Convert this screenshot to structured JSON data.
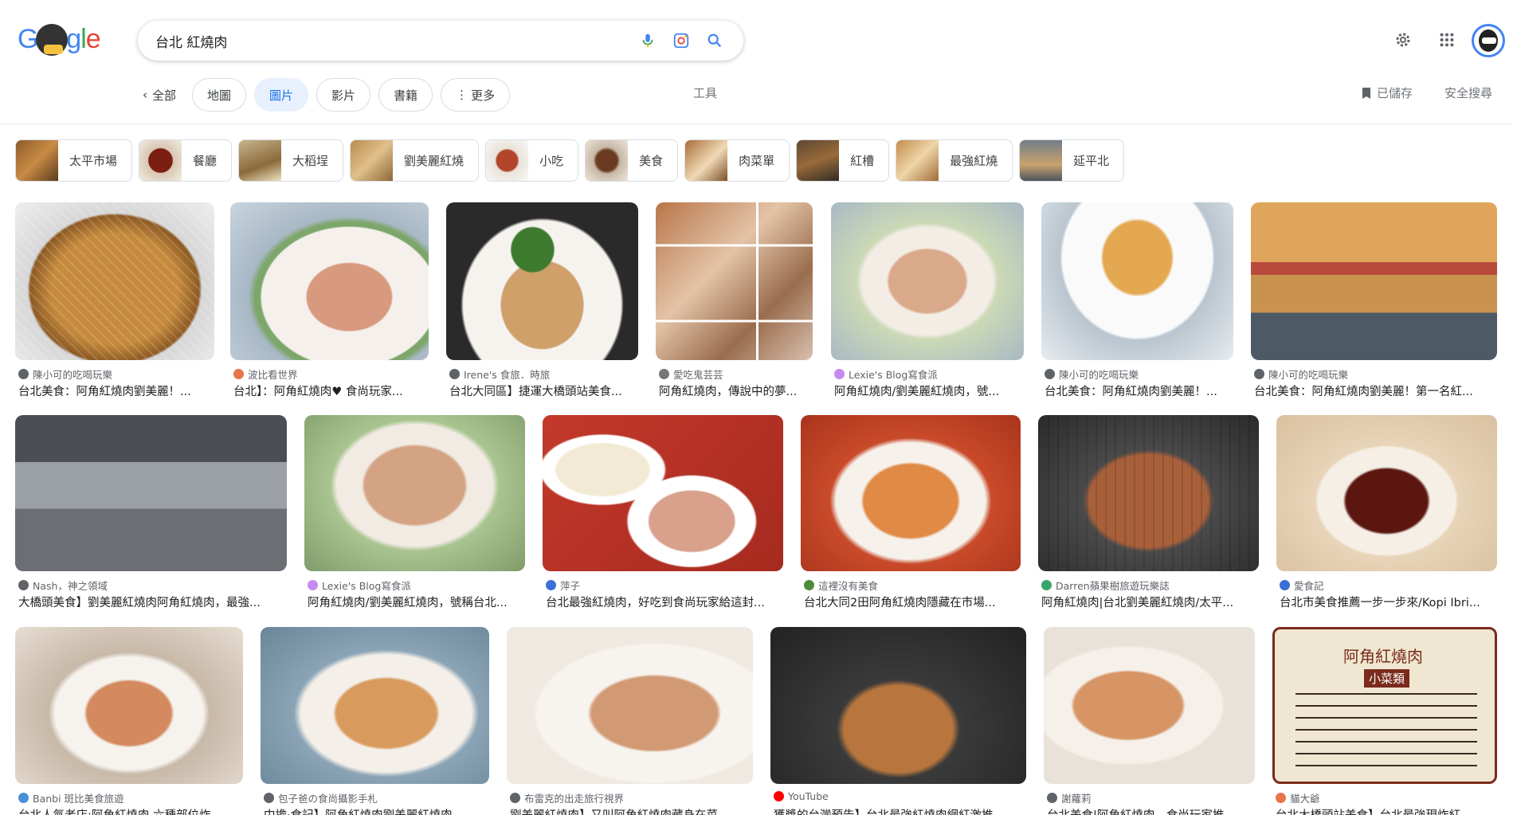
{
  "logo": {
    "text": "Google"
  },
  "search": {
    "query": "台北 紅燒肉"
  },
  "icons": {
    "mic": "mic-icon",
    "lens": "camera-lens-icon",
    "search": "search-icon",
    "settings": "gear-icon",
    "apps": "grid-apps-icon",
    "saved": "bookmark-icon"
  },
  "tabs": {
    "back_label": "全部",
    "items": [
      {
        "label": "地圖",
        "active": false
      },
      {
        "label": "圖片",
        "active": true
      },
      {
        "label": "影片",
        "active": false
      },
      {
        "label": "書籍",
        "active": false
      },
      {
        "label": "更多",
        "active": false
      }
    ],
    "tools": "工具",
    "saved": "已儲存",
    "safesearch": "安全搜尋"
  },
  "related": [
    {
      "label": "太平市場"
    },
    {
      "label": "餐廳"
    },
    {
      "label": "大稻埕"
    },
    {
      "label": "劉美麗紅燒"
    },
    {
      "label": "小吃"
    },
    {
      "label": "美食"
    },
    {
      "label": "肉菜單"
    },
    {
      "label": "紅槽"
    },
    {
      "label": "最強紅燒"
    },
    {
      "label": "延平北"
    }
  ],
  "results": [
    {
      "source": "陳小可的吃喝玩樂",
      "title": "台北美食：阿角紅燒肉劉美麗！..."
    },
    {
      "source": "波比看世界",
      "title": "台北】：阿角紅燒肉♥ 食尚玩家..."
    },
    {
      "source": "Irene's 食旅．時旅",
      "title": "台北大同區】捷運大橋頭站美食..."
    },
    {
      "source": "愛吃鬼芸芸",
      "title": "阿角紅燒肉，傳說中的夢..."
    },
    {
      "source": "Lexie's Blog寫食派",
      "title": "阿角紅燒肉/劉美麗紅燒肉，號..."
    },
    {
      "source": "陳小可的吃喝玩樂",
      "title": "台北美食：阿角紅燒肉劉美麗！..."
    },
    {
      "source": "陳小可的吃喝玩樂",
      "title": "台北美食：阿角紅燒肉劉美麗！第一名紅..."
    },
    {
      "source": "Nash，神之領域",
      "title": "大橋頭美食】劉美麗紅燒肉阿角紅燒肉，最強..."
    },
    {
      "source": "Lexie's Blog寫食派",
      "title": "阿角紅燒肉/劉美麗紅燒肉，號稱台北..."
    },
    {
      "source": "萍子",
      "title": "台北最強紅燒肉，好吃到食尚玩家給這封..."
    },
    {
      "source": "這裡沒有美食",
      "title": "台北大同2田阿角紅燒肉隱藏在市場..."
    },
    {
      "source": "Darren蘋果樹旅遊玩樂誌",
      "title": "阿角紅燒肉|台北劉美麗紅燒肉/太平..."
    },
    {
      "source": "愛食記",
      "title": "台北市美食推薦一步一步來/Kopi Ibri..."
    },
    {
      "source": "Banbi 斑比美食旅遊",
      "title": "台北人氣老店:阿角紅燒肉 六種部位炸..."
    },
    {
      "source": "包子爸の食尚攝影手札",
      "title": "中擔·食記】阿角紅燒肉劉美麗紅燒肉..."
    },
    {
      "source": "布雷克的出走旅行視界",
      "title": "劉美麗紅燒肉】又叫阿角紅燒肉藏身在菜..."
    },
    {
      "source": "YouTube",
      "title": "獲獎的台灣預告】台北最強紅燒肉網紅激推..."
    },
    {
      "source": "謝蘿莉",
      "title": "台北美食|阿角紅燒肉，食尚玩家推..."
    },
    {
      "source": "貓大爺",
      "title": "台北大橋頭站美食】台北最強現炸紅..."
    }
  ],
  "menu_board": {
    "title": "阿角紅燒肉",
    "subtitle": "小菜類"
  },
  "colors": {
    "accent": "#1a73e8",
    "chip_active_bg": "#e8f0fe",
    "text_secondary": "#70757a"
  }
}
